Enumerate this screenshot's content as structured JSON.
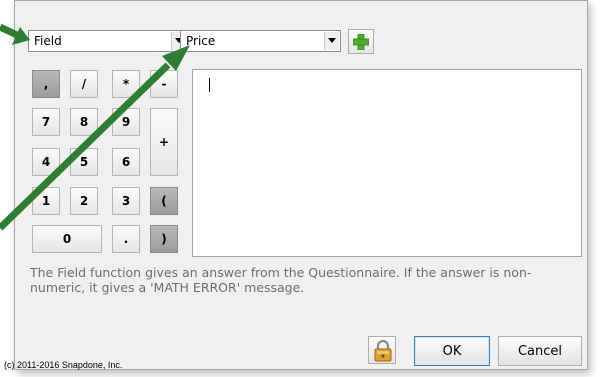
{
  "field_select": {
    "value": "Field"
  },
  "price_select": {
    "value": "Price"
  },
  "keypad": {
    "keys": [
      ",",
      "/",
      "*",
      "-",
      "7",
      "8",
      "9",
      "+",
      "4",
      "5",
      "6",
      "1",
      "2",
      "3",
      "(",
      "0",
      ".",
      ")"
    ]
  },
  "help_text": "The Field function gives an answer from the Questionnaire.  If the answer is non-numeric, it gives a 'MATH ERROR' message.",
  "buttons": {
    "ok": "OK",
    "cancel": "Cancel"
  },
  "copyright": "(c) 2011-2016 Snapdone, Inc.",
  "colors": {
    "arrow": "#2e7d32",
    "dialog_bg": "#f0f0f0",
    "dark_key": "#a8a8a8",
    "help_text": "#6d6d6d"
  },
  "icons": [
    "chevron-down-icon",
    "plus-icon",
    "lock-icon",
    "arrow-icon"
  ]
}
